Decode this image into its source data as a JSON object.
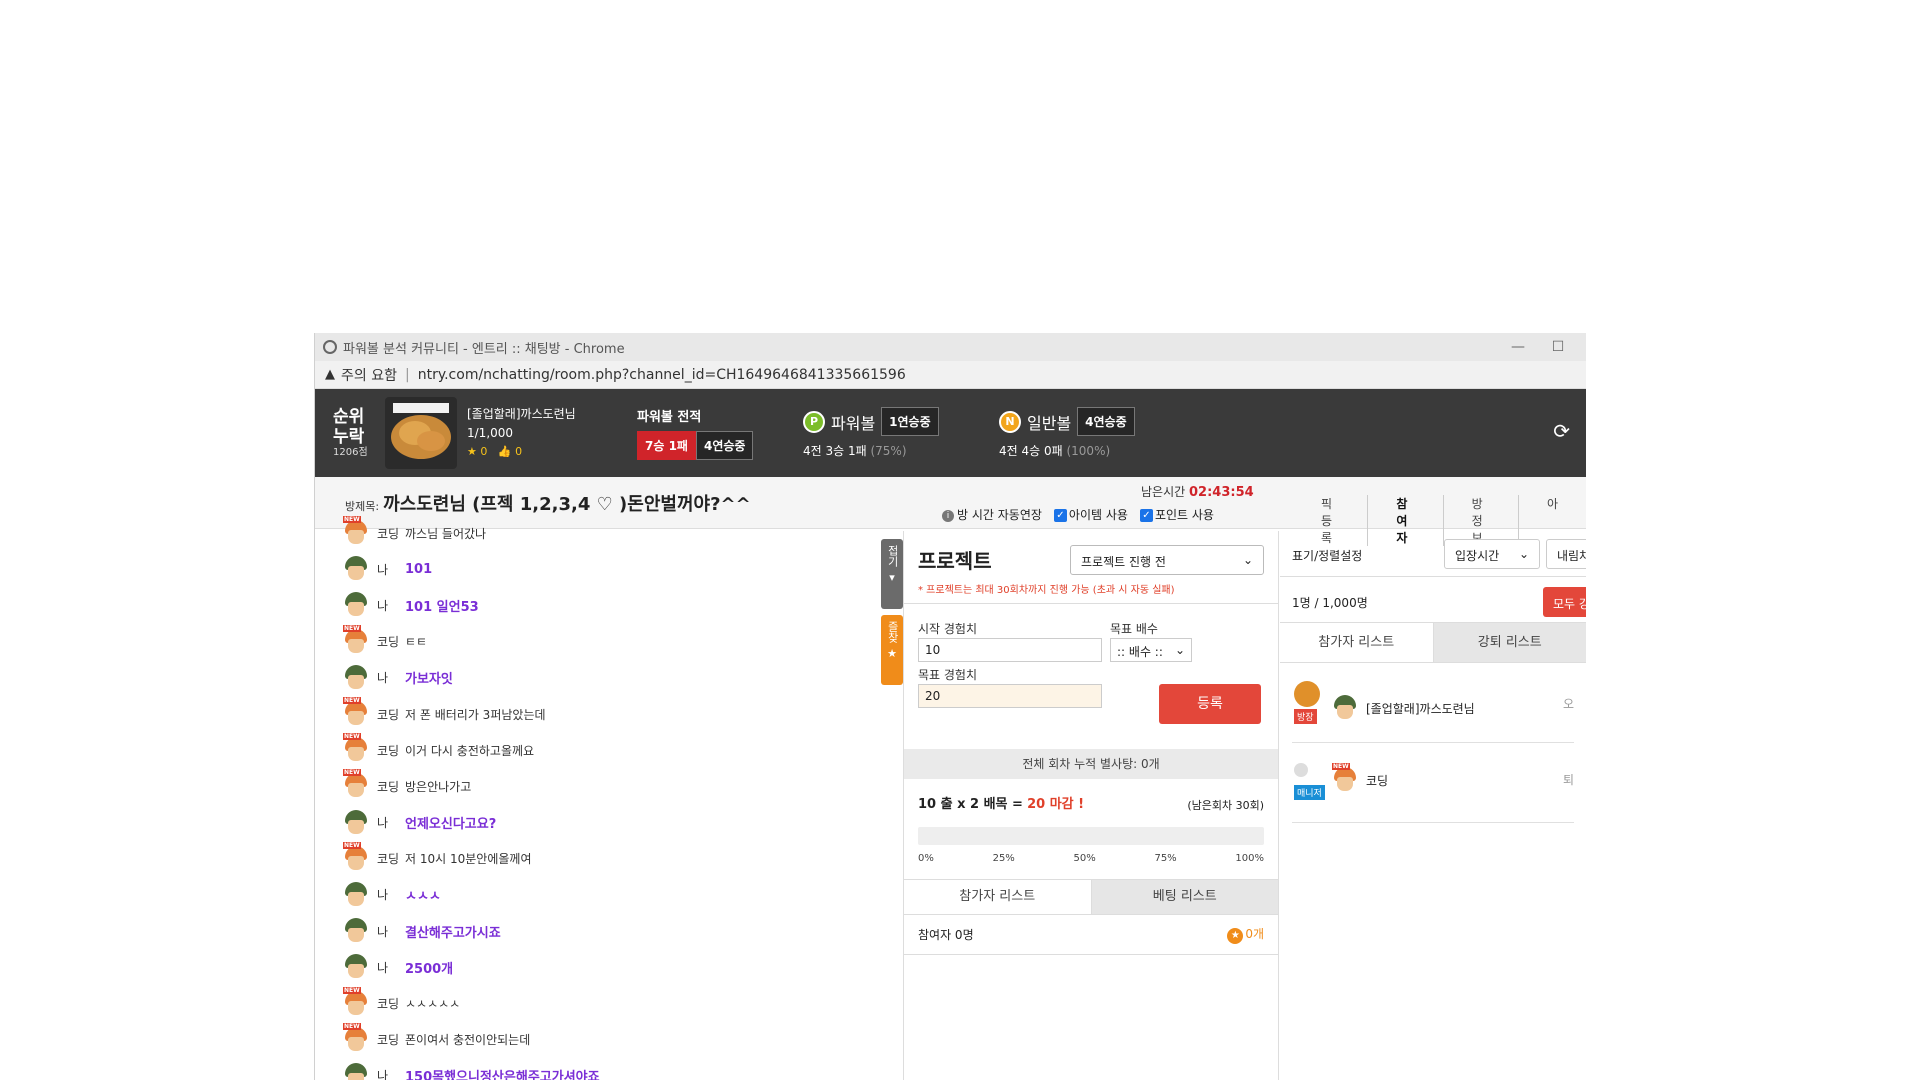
{
  "window": {
    "title": "파워볼 분석 커뮤니티 - 엔트리 :: 채팅방 - Chrome",
    "security": "주의 요함",
    "url": "ntry.com/nchatting/room.php?channel_id=CH1649646841335661596"
  },
  "profile": {
    "rank_label_1": "순위",
    "rank_label_2": "누락",
    "points": "1206점",
    "name": "[졸업할래]까스도련님",
    "count": "1/1,000",
    "star_count": "0",
    "like_count": "0",
    "record_label": "파워볼 전적",
    "record_result": "7승 1패",
    "record_streak": "4연승중"
  },
  "balls": [
    {
      "icon": "P",
      "name": "파워볼",
      "streak": "1연승중",
      "summary": "4전 3승 1패",
      "pct": "(75%)"
    },
    {
      "icon": "N",
      "name": "일반볼",
      "streak": "4연승중",
      "summary": "4전 4승 0패",
      "pct": "(100%)"
    }
  ],
  "room": {
    "title_label": "방제목:",
    "title": "까스도련님 (프젝 1,2,3,4 ♡ )돈안벌꺼야?^^",
    "timer_label": "남은시간",
    "timer": "02:43:54",
    "opt_auto": "방 시간 자동연장",
    "opt_item": "아이템 사용",
    "opt_point": "포인트 사용",
    "tabs": [
      "픽등록",
      "참여자",
      "방정보",
      "아"
    ]
  },
  "chat": [
    {
      "who": "other",
      "nick": "코딩",
      "text": "까스님 들어갔나"
    },
    {
      "who": "me",
      "nick": "나",
      "text": "101"
    },
    {
      "who": "me",
      "nick": "나",
      "text": "101 일언53"
    },
    {
      "who": "other",
      "nick": "코딩",
      "text": "ㅌㅌ"
    },
    {
      "who": "me",
      "nick": "나",
      "text": "가보자잇"
    },
    {
      "who": "other",
      "nick": "코딩",
      "text": "저 폰 배터리가 3퍼남았는데"
    },
    {
      "who": "other",
      "nick": "코딩",
      "text": "이거 다시 충전하고올께요"
    },
    {
      "who": "other",
      "nick": "코딩",
      "text": "방은안나가고"
    },
    {
      "who": "me",
      "nick": "나",
      "text": "언제오신다고요?"
    },
    {
      "who": "other",
      "nick": "코딩",
      "text": "저 10시 10분안에올께여"
    },
    {
      "who": "me",
      "nick": "나",
      "text": "ㅅㅅㅅ"
    },
    {
      "who": "me",
      "nick": "나",
      "text": "결산해주고가시죠"
    },
    {
      "who": "me",
      "nick": "나",
      "text": "2500개"
    },
    {
      "who": "other",
      "nick": "코딩",
      "text": "ㅅㅅㅅㅅㅅ"
    },
    {
      "who": "other",
      "nick": "코딩",
      "text": "폰이여서 충전이안되는데"
    },
    {
      "who": "me",
      "nick": "나",
      "text": "150목했으니정산은해주고가셔야죠"
    }
  ],
  "side": {
    "fold": "접기",
    "fav": "즐찾"
  },
  "project": {
    "title": "프로젝트",
    "status": "프로젝트 진행 전",
    "note": "* 프로젝트는 최대 30회차까지 진행 가능 (초과 시 자동 실패)",
    "start_label": "시작 경험치",
    "start_value": "10",
    "target_label": "목표 경험치",
    "target_value": "20",
    "multiplier_label": "목표 배수",
    "multiplier_value": ":: 배수 ::",
    "register": "등록",
    "total": "전체 회차 누적 별사탕: 0개",
    "goal_a": "10 출 x 2 배목 =",
    "goal_b": "20 마감 !",
    "remaining": "(남은회차 30회)",
    "progress": 0,
    "ticks": [
      "0%",
      "25%",
      "50%",
      "75%",
      "100%"
    ],
    "tabs": [
      "참가자 리스트",
      "베팅 리스트"
    ],
    "participants": "참여자 0명",
    "stars": "0개"
  },
  "users": {
    "sort_label": "표기/정렬설정",
    "sort1": "입장시간",
    "sort2": "내림차순",
    "count": "1명 / 1,000명",
    "kick_all": "모두 강제퇴장",
    "tabs": [
      "참가자 리스트",
      "강퇴 리스트"
    ],
    "list": [
      {
        "role": "방장",
        "name": "[졸업할래]까스도련님",
        "action": "오"
      },
      {
        "role": "매니저",
        "name": "코딩",
        "action": "퇴"
      }
    ]
  }
}
